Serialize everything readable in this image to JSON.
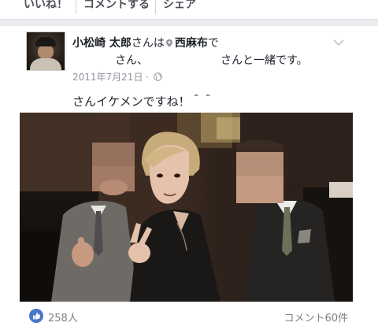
{
  "action_bar": {
    "like_label": "いいね！",
    "comment_label": "コメントする",
    "share_label": "シェア"
  },
  "post": {
    "author_name": "小松崎 太郎",
    "author_suffix": "さんは",
    "location_name": "西麻布",
    "location_suffix": "で",
    "tag_line_1": "さん、",
    "tag_line_2": "さんと一緒です。",
    "date": "2011年7月21日",
    "date_sep": "·",
    "text": "さんイケメンですね！＾＾"
  },
  "footer": {
    "like_count": "258人",
    "comment_count": "コメント60件"
  },
  "icons": {
    "location": "location-pin-icon",
    "privacy": "globe-icon",
    "menu": "chevron-down-icon",
    "like": "thumbs-up-icon"
  },
  "colors": {
    "name_text": "#1d2129",
    "meta_text": "#90949c",
    "footer_text": "#7f7f7f",
    "like_blue": "#4a76c9",
    "divider": "#e9ebee"
  }
}
